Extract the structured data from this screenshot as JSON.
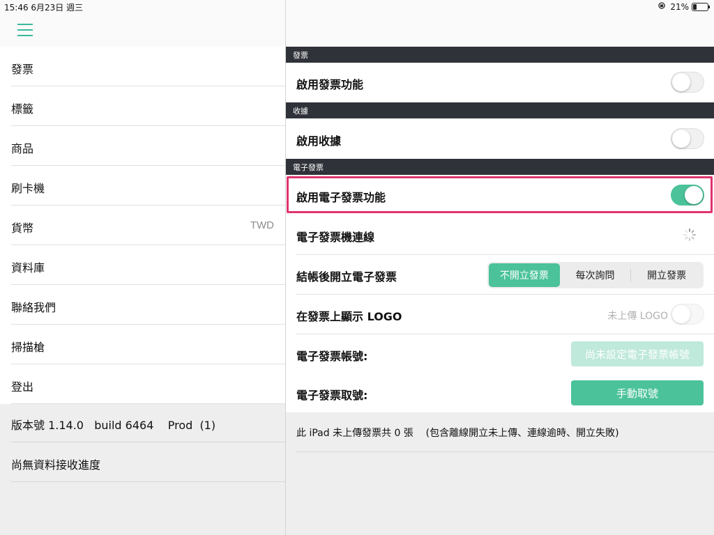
{
  "status_bar": {
    "time_date": "15:46  6月23日 週三",
    "battery_pct": "21%",
    "battery_level": 0.21,
    "icons": [
      "orientation-lock-icon",
      "battery-icon"
    ]
  },
  "sidebar": {
    "items": [
      {
        "label": "發票",
        "value": ""
      },
      {
        "label": "標籤",
        "value": ""
      },
      {
        "label": "商品",
        "value": ""
      },
      {
        "label": "刷卡機",
        "value": ""
      },
      {
        "label": "貨幣",
        "value": "TWD"
      },
      {
        "label": "資料庫",
        "value": ""
      },
      {
        "label": "聯絡我們",
        "value": ""
      },
      {
        "label": "掃描槍",
        "value": ""
      },
      {
        "label": "登出",
        "value": ""
      }
    ],
    "version": "版本號 1.14.0   build 6464    Prod  (1)",
    "receive_progress": "尚無資料接收進度"
  },
  "main": {
    "sections": {
      "invoice": {
        "header": "發票",
        "enable_label": "啟用發票功能",
        "enabled": false
      },
      "receipt": {
        "header": "收據",
        "enable_label": "啟用收據",
        "enabled": false
      },
      "einvoice": {
        "header": "電子發票",
        "enable_label": "啟用電子發票功能",
        "enabled": true,
        "connection_label": "電子發票機連線",
        "issue_label": "結帳後開立電子發票",
        "issue_options": [
          "不開立發票",
          "每次詢問",
          "開立發票"
        ],
        "issue_selected": "不開立發票",
        "logo_label": "在發票上顯示 LOGO",
        "logo_note": "未上傳 LOGO",
        "account_label": "電子發票帳號:",
        "account_button": "尚未設定電子發票帳號",
        "number_label": "電子發票取號:",
        "number_button": "手動取號"
      }
    },
    "footer_text": "此 iPad 未上傳發票共 0 張    (包含離線開立未上傳、連線逾時、開立失敗)"
  },
  "colors": {
    "accent": "#4bc29a",
    "header_bg": "#2f3238",
    "highlight": "#e0336f"
  }
}
